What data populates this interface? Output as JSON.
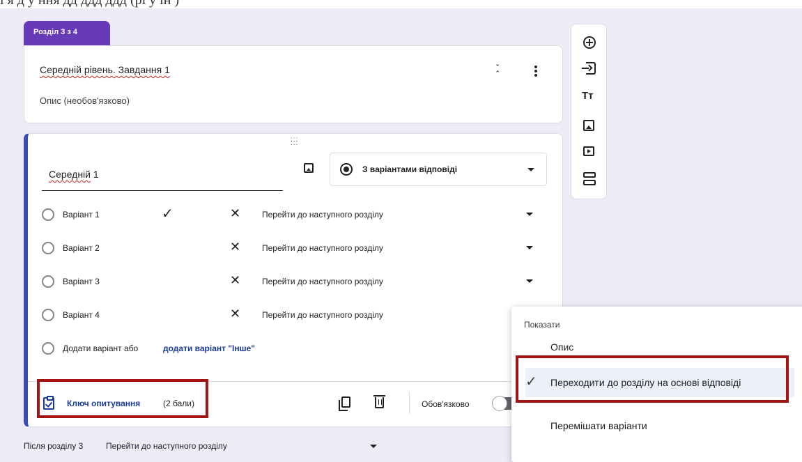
{
  "section_tab": {
    "label": "Розділ 3 з 4"
  },
  "section_header": {
    "title_prefix": "Середній рівень",
    "title_suffix": ". Завдання 1",
    "description_placeholder": "Опис (необов'язково)"
  },
  "question": {
    "title": "Середній",
    "title_suffix": " 1",
    "type_label": "З варіантами відповіді",
    "options": [
      {
        "label": "Варіант 1",
        "correct": true,
        "goto": "Перейти до наступного розділу"
      },
      {
        "label": "Варіант 2",
        "correct": false,
        "goto": "Перейти до наступного розділу"
      },
      {
        "label": "Варіант 3",
        "correct": false,
        "goto": "Перейти до наступного розділу"
      },
      {
        "label": "Варіант 4",
        "correct": false,
        "goto": "Перейти до наступного розділу"
      }
    ],
    "add_option_text": "Додати варіант  або",
    "add_other_text": "додати варіант \"Інше\"",
    "answer_key_label": "Ключ опитування",
    "points_label": "(2 бали)",
    "required_label": "Обов'язково"
  },
  "after_section": {
    "label": "Після розділу 3",
    "goto": "Перейти до наступного розділу"
  },
  "menu": {
    "header": "Показати",
    "items": [
      {
        "label": "Опис",
        "checked": false
      },
      {
        "label": "Переходити до розділу на основі відповіді",
        "checked": true
      },
      {
        "label": "Перемішати варіанти",
        "checked": false
      }
    ]
  },
  "colors": {
    "accent": "#673ab7",
    "question_border": "#3a4bb5",
    "link_blue": "#1a3a9c",
    "highlight_red": "#a31515",
    "background": "#efebf6"
  },
  "icons": [
    "collapse-icon",
    "more-vert-icon",
    "drag-handle-icon",
    "image-icon",
    "radio-icon",
    "dropdown-caret-icon",
    "check-icon",
    "close-icon",
    "answer-key-icon",
    "copy-icon",
    "trash-icon",
    "add-circle-icon",
    "import-icon",
    "title-icon",
    "video-icon",
    "section-icon"
  ]
}
